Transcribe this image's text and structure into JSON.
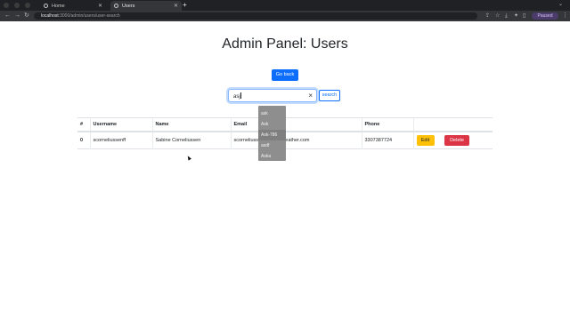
{
  "browser": {
    "tabs": [
      {
        "label": "Home",
        "active": false
      },
      {
        "label": "Users",
        "active": true
      }
    ],
    "new_tab": "+",
    "url_host": "localhost",
    "url_path": ":3000/admin/users/user-search",
    "paused_label": "Paused",
    "icons": [
      "back-arrow-icon",
      "forward-arrow-icon",
      "reload-icon",
      "share-icon",
      "bookmark-star-icon",
      "download-icon",
      "extensions-icon",
      "sidebar-icon",
      "profile-icon",
      "kebab-menu-icon"
    ]
  },
  "page": {
    "title": "Admin Panel: Users",
    "back_button": "Go back",
    "search": {
      "value": "asj",
      "clear_symbol": "×",
      "button": "search",
      "suggestions": [
        "ask",
        "Ask",
        "Ask-786",
        "asdf",
        "Aska"
      ]
    },
    "table": {
      "headers": [
        "#",
        "Username",
        "Name",
        "Email",
        "Phone",
        ""
      ],
      "rows": [
        {
          "index": "0",
          "username": "scorneliussenff",
          "name": "Sabine Corneliussen",
          "email": "scorneliussenff@accuweather.com",
          "phone": "3307387724",
          "edit": "Edit",
          "delete": "Delete"
        }
      ]
    }
  },
  "colors": {
    "primary": "#0d6efd",
    "warning": "#ffc107",
    "danger": "#dc3545",
    "chrome_dark": "#202124"
  }
}
